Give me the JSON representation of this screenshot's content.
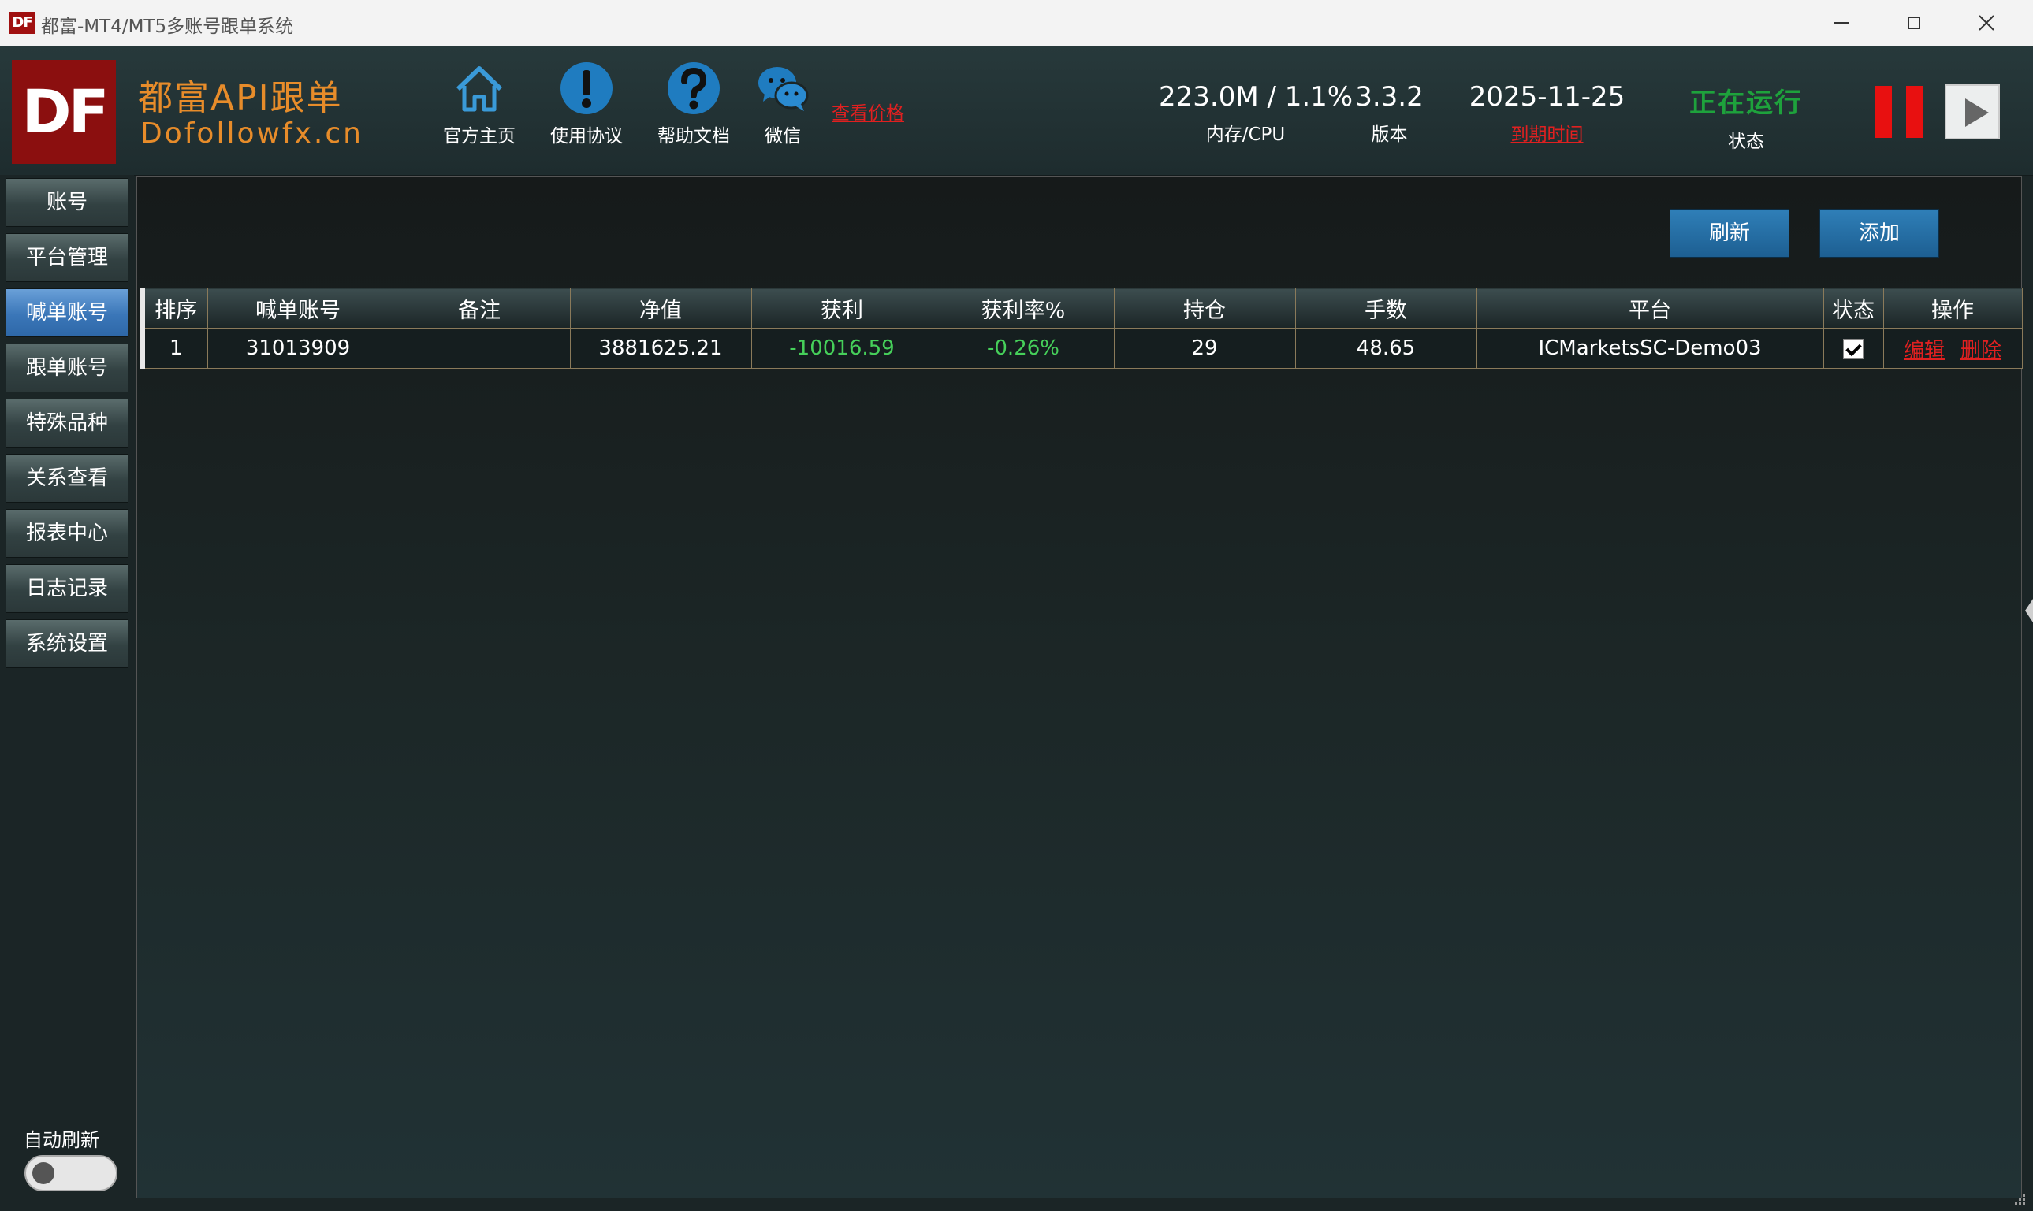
{
  "window": {
    "icon_text": "DF",
    "title": "都富-MT4/MT5多账号跟单系统"
  },
  "header": {
    "logo_text": "DF",
    "brand_title": "都富API跟单",
    "brand_url": "Dofollowfx.cn",
    "nav": [
      {
        "label": "官方主页",
        "icon": "home-icon"
      },
      {
        "label": "使用协议",
        "icon": "exclamation-icon"
      },
      {
        "label": "帮助文档",
        "icon": "question-icon"
      },
      {
        "label": "微信",
        "icon": "wechat-icon"
      }
    ],
    "price_link": "查看价格",
    "stats": {
      "mem_cpu_value": "223.0M / 1.1%",
      "mem_cpu_label": "内存/CPU",
      "version_value": "3.3.2",
      "version_label": "版本",
      "expiry_value": "2025-11-25",
      "expiry_label": "到期时间",
      "status_value": "正在运行",
      "status_label": "状态"
    },
    "colors": {
      "accent": "#e78c2a",
      "running": "#1ea23c",
      "alert": "#e02020"
    }
  },
  "sidebar": {
    "items": [
      {
        "label": "账号",
        "active": false
      },
      {
        "label": "平台管理",
        "active": false
      },
      {
        "label": "喊单账号",
        "active": true
      },
      {
        "label": "跟单账号",
        "active": false
      },
      {
        "label": "特殊品种",
        "active": false
      },
      {
        "label": "关系查看",
        "active": false
      },
      {
        "label": "报表中心",
        "active": false
      },
      {
        "label": "日志记录",
        "active": false
      },
      {
        "label": "系统设置",
        "active": false
      }
    ],
    "auto_refresh_label": "自动刷新",
    "auto_refresh_on": false
  },
  "toolbar": {
    "refresh_label": "刷新",
    "add_label": "添加"
  },
  "table": {
    "columns": [
      "排序",
      "喊单账号",
      "备注",
      "净值",
      "获利",
      "获利率%",
      "持仓",
      "手数",
      "平台",
      "状态",
      "操作"
    ],
    "rows": [
      {
        "order": "1",
        "account": "31013909",
        "note": "",
        "equity": "3881625.21",
        "profit": "-10016.59",
        "profit_rate": "-0.26%",
        "positions": "29",
        "lots": "48.65",
        "platform": "ICMarketsSC-Demo03",
        "enabled": true,
        "edit_label": "编辑",
        "delete_label": "删除"
      }
    ]
  }
}
